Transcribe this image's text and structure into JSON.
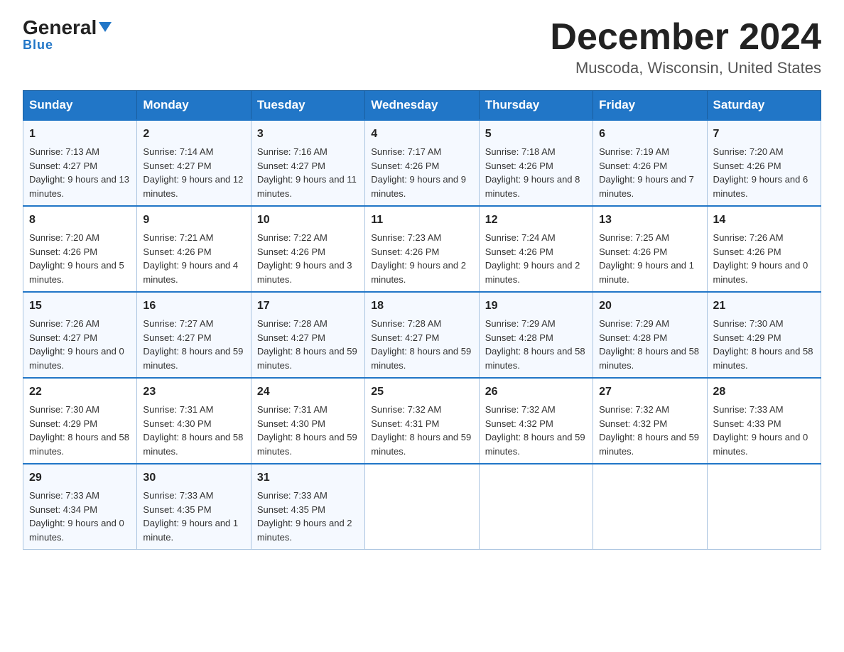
{
  "header": {
    "logo_general": "General",
    "logo_blue": "Blue",
    "calendar_title": "December 2024",
    "calendar_subtitle": "Muscoda, Wisconsin, United States"
  },
  "weekdays": [
    "Sunday",
    "Monday",
    "Tuesday",
    "Wednesday",
    "Thursday",
    "Friday",
    "Saturday"
  ],
  "weeks": [
    [
      {
        "day": "1",
        "sunrise": "7:13 AM",
        "sunset": "4:27 PM",
        "daylight": "9 hours and 13 minutes."
      },
      {
        "day": "2",
        "sunrise": "7:14 AM",
        "sunset": "4:27 PM",
        "daylight": "9 hours and 12 minutes."
      },
      {
        "day": "3",
        "sunrise": "7:16 AM",
        "sunset": "4:27 PM",
        "daylight": "9 hours and 11 minutes."
      },
      {
        "day": "4",
        "sunrise": "7:17 AM",
        "sunset": "4:26 PM",
        "daylight": "9 hours and 9 minutes."
      },
      {
        "day": "5",
        "sunrise": "7:18 AM",
        "sunset": "4:26 PM",
        "daylight": "9 hours and 8 minutes."
      },
      {
        "day": "6",
        "sunrise": "7:19 AM",
        "sunset": "4:26 PM",
        "daylight": "9 hours and 7 minutes."
      },
      {
        "day": "7",
        "sunrise": "7:20 AM",
        "sunset": "4:26 PM",
        "daylight": "9 hours and 6 minutes."
      }
    ],
    [
      {
        "day": "8",
        "sunrise": "7:20 AM",
        "sunset": "4:26 PM",
        "daylight": "9 hours and 5 minutes."
      },
      {
        "day": "9",
        "sunrise": "7:21 AM",
        "sunset": "4:26 PM",
        "daylight": "9 hours and 4 minutes."
      },
      {
        "day": "10",
        "sunrise": "7:22 AM",
        "sunset": "4:26 PM",
        "daylight": "9 hours and 3 minutes."
      },
      {
        "day": "11",
        "sunrise": "7:23 AM",
        "sunset": "4:26 PM",
        "daylight": "9 hours and 2 minutes."
      },
      {
        "day": "12",
        "sunrise": "7:24 AM",
        "sunset": "4:26 PM",
        "daylight": "9 hours and 2 minutes."
      },
      {
        "day": "13",
        "sunrise": "7:25 AM",
        "sunset": "4:26 PM",
        "daylight": "9 hours and 1 minute."
      },
      {
        "day": "14",
        "sunrise": "7:26 AM",
        "sunset": "4:26 PM",
        "daylight": "9 hours and 0 minutes."
      }
    ],
    [
      {
        "day": "15",
        "sunrise": "7:26 AM",
        "sunset": "4:27 PM",
        "daylight": "9 hours and 0 minutes."
      },
      {
        "day": "16",
        "sunrise": "7:27 AM",
        "sunset": "4:27 PM",
        "daylight": "8 hours and 59 minutes."
      },
      {
        "day": "17",
        "sunrise": "7:28 AM",
        "sunset": "4:27 PM",
        "daylight": "8 hours and 59 minutes."
      },
      {
        "day": "18",
        "sunrise": "7:28 AM",
        "sunset": "4:27 PM",
        "daylight": "8 hours and 59 minutes."
      },
      {
        "day": "19",
        "sunrise": "7:29 AM",
        "sunset": "4:28 PM",
        "daylight": "8 hours and 58 minutes."
      },
      {
        "day": "20",
        "sunrise": "7:29 AM",
        "sunset": "4:28 PM",
        "daylight": "8 hours and 58 minutes."
      },
      {
        "day": "21",
        "sunrise": "7:30 AM",
        "sunset": "4:29 PM",
        "daylight": "8 hours and 58 minutes."
      }
    ],
    [
      {
        "day": "22",
        "sunrise": "7:30 AM",
        "sunset": "4:29 PM",
        "daylight": "8 hours and 58 minutes."
      },
      {
        "day": "23",
        "sunrise": "7:31 AM",
        "sunset": "4:30 PM",
        "daylight": "8 hours and 58 minutes."
      },
      {
        "day": "24",
        "sunrise": "7:31 AM",
        "sunset": "4:30 PM",
        "daylight": "8 hours and 59 minutes."
      },
      {
        "day": "25",
        "sunrise": "7:32 AM",
        "sunset": "4:31 PM",
        "daylight": "8 hours and 59 minutes."
      },
      {
        "day": "26",
        "sunrise": "7:32 AM",
        "sunset": "4:32 PM",
        "daylight": "8 hours and 59 minutes."
      },
      {
        "day": "27",
        "sunrise": "7:32 AM",
        "sunset": "4:32 PM",
        "daylight": "8 hours and 59 minutes."
      },
      {
        "day": "28",
        "sunrise": "7:33 AM",
        "sunset": "4:33 PM",
        "daylight": "9 hours and 0 minutes."
      }
    ],
    [
      {
        "day": "29",
        "sunrise": "7:33 AM",
        "sunset": "4:34 PM",
        "daylight": "9 hours and 0 minutes."
      },
      {
        "day": "30",
        "sunrise": "7:33 AM",
        "sunset": "4:35 PM",
        "daylight": "9 hours and 1 minute."
      },
      {
        "day": "31",
        "sunrise": "7:33 AM",
        "sunset": "4:35 PM",
        "daylight": "9 hours and 2 minutes."
      },
      null,
      null,
      null,
      null
    ]
  ]
}
